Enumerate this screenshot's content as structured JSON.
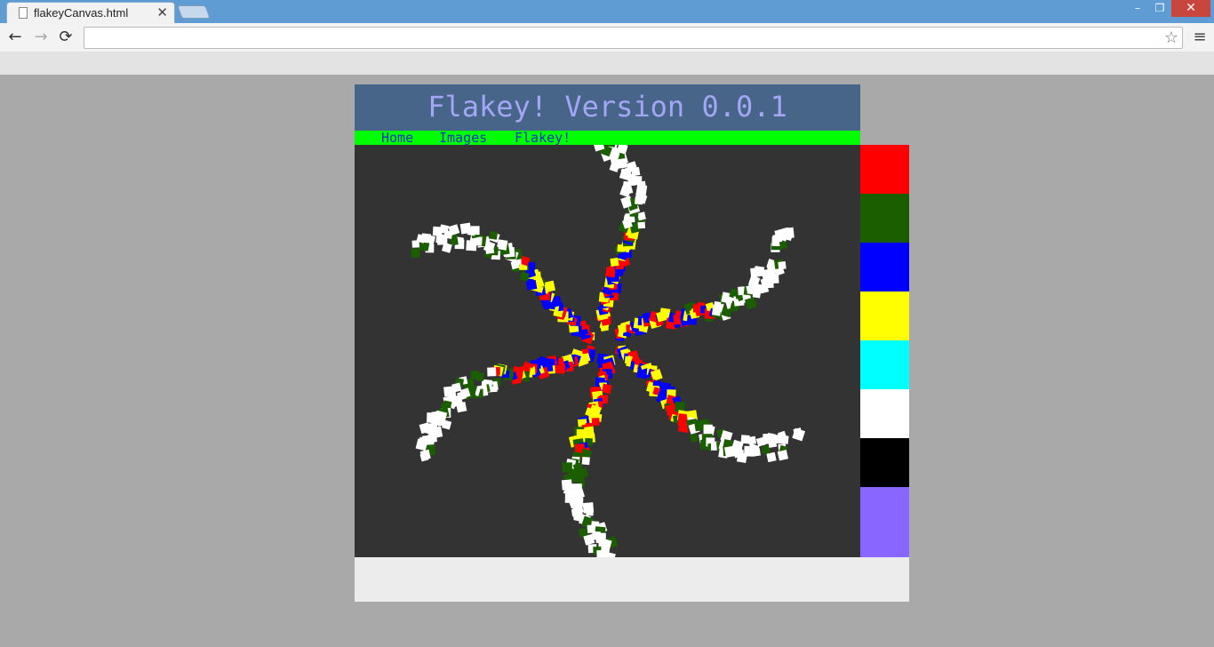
{
  "browser": {
    "tab_title": "flakeyCanvas.html",
    "tab_close": "✕",
    "url": "",
    "window_minimize": "–",
    "window_maximize": "❐",
    "window_close": "✕",
    "back_icon": "←",
    "forward_icon": "→",
    "reload_icon": "⟳",
    "star_icon": "☆",
    "menu_icon": "≡"
  },
  "page": {
    "title": "Flakey! Version 0.0.1",
    "nav": {
      "home": "Home",
      "images": "Images",
      "flakey": "Flakey!"
    },
    "canvas_background": "#333333",
    "palette": [
      {
        "name": "red",
        "color": "#ff0000"
      },
      {
        "name": "dark-green",
        "color": "#1a5e00"
      },
      {
        "name": "blue",
        "color": "#0000ff"
      },
      {
        "name": "yellow",
        "color": "#ffff00"
      },
      {
        "name": "cyan",
        "color": "#00ffff"
      },
      {
        "name": "white",
        "color": "#ffffff"
      },
      {
        "name": "black",
        "color": "#000000"
      },
      {
        "name": "purple",
        "color": "#8866ff"
      }
    ],
    "flake": {
      "arms": 6,
      "colors": [
        "#ff0000",
        "#ffff00",
        "#0000ff",
        "#1a5e00",
        "#ffffff"
      ]
    }
  }
}
